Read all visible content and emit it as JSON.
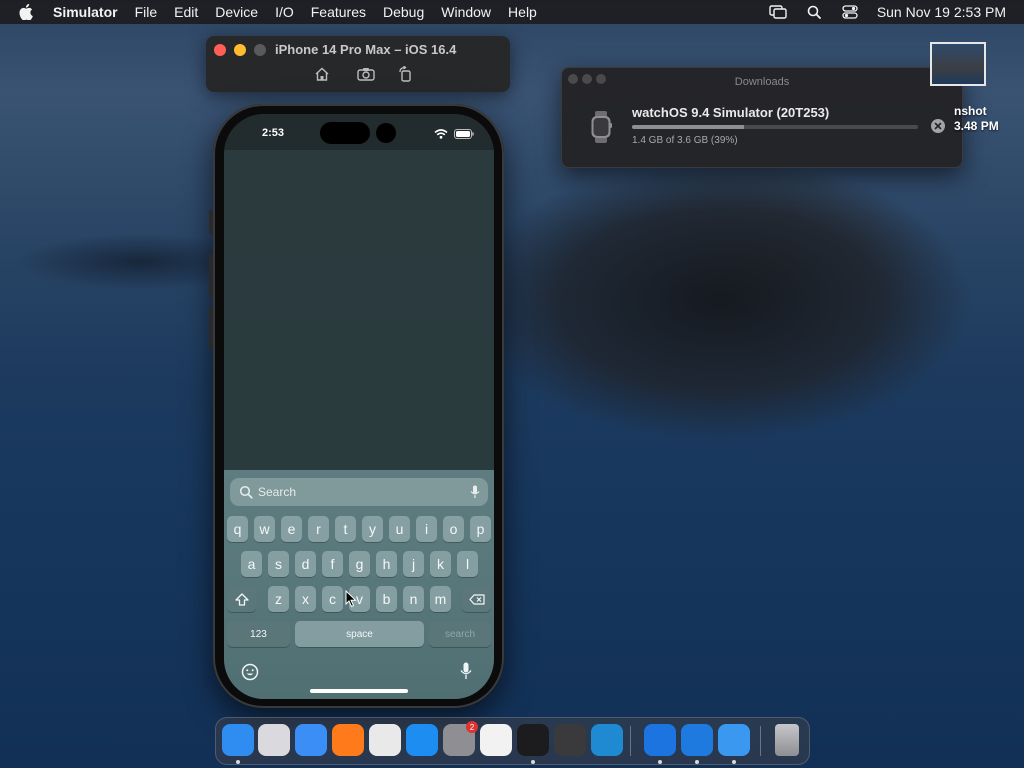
{
  "menubar": {
    "apple_icon": "apple-logo-icon",
    "app_name": "Simulator",
    "menus": [
      "File",
      "Edit",
      "Device",
      "I/O",
      "Features",
      "Debug",
      "Window",
      "Help"
    ],
    "status_icons": [
      "screen-mirroring-icon",
      "spotlight-search-icon",
      "control-center-icon"
    ],
    "clock": "Sun Nov 19  2:53 PM"
  },
  "simulator_window": {
    "title": "iPhone 14 Pro Max – iOS 16.4",
    "tools": [
      "home-icon",
      "screenshot-icon",
      "rotate-icon"
    ],
    "traffic_colors": {
      "close": "#ff5f57",
      "minimize": "#febc2e",
      "zoom": "#5a5a5d"
    }
  },
  "phone": {
    "status_time": "2:53",
    "search_placeholder": "Search",
    "keyboard_rows": [
      [
        "q",
        "w",
        "e",
        "r",
        "t",
        "y",
        "u",
        "i",
        "o",
        "p"
      ],
      [
        "a",
        "s",
        "d",
        "f",
        "g",
        "h",
        "j",
        "k",
        "l"
      ],
      [
        "z",
        "x",
        "c",
        "v",
        "b",
        "n",
        "m"
      ]
    ],
    "key_123": "123",
    "key_space": "space",
    "key_search": "search"
  },
  "downloads": {
    "title": "Downloads",
    "item_name": "watchOS 9.4 Simulator (20T253)",
    "progress_text": "1.4 GB of 3.6 GB (39%)",
    "progress_fraction": 0.39
  },
  "desktop": {
    "item_label_line1": "nshot",
    "item_label_line2": "3.48 PM"
  },
  "dock": {
    "apps": [
      {
        "name": "finder",
        "color": "#2f8cf0",
        "running": true
      },
      {
        "name": "launchpad",
        "color": "#d9d9de",
        "running": false
      },
      {
        "name": "safari",
        "color": "#3a8ef5",
        "running": false
      },
      {
        "name": "firefox",
        "color": "#ff7a1a",
        "running": false
      },
      {
        "name": "chrome",
        "color": "#e9e9ea",
        "running": false
      },
      {
        "name": "app-store",
        "color": "#1d8df2",
        "running": false
      },
      {
        "name": "system-settings",
        "color": "#8e8e93",
        "running": false,
        "badge": "2"
      },
      {
        "name": "textedit",
        "color": "#f2f2f2",
        "running": false
      },
      {
        "name": "terminal",
        "color": "#1c1c1e",
        "running": true
      },
      {
        "name": "instruments",
        "color": "#3a3a3c",
        "running": false
      },
      {
        "name": "vscode",
        "color": "#1f8ad2",
        "running": false
      },
      {
        "name": "simulator",
        "color": "#1b74e0",
        "running": true
      },
      {
        "name": "xcode",
        "color": "#1f7ae0",
        "running": true
      },
      {
        "name": "xcode-beta",
        "color": "#3a98f0",
        "running": true
      },
      {
        "name": "trash",
        "color": "#9a9aa0",
        "running": false
      }
    ]
  }
}
